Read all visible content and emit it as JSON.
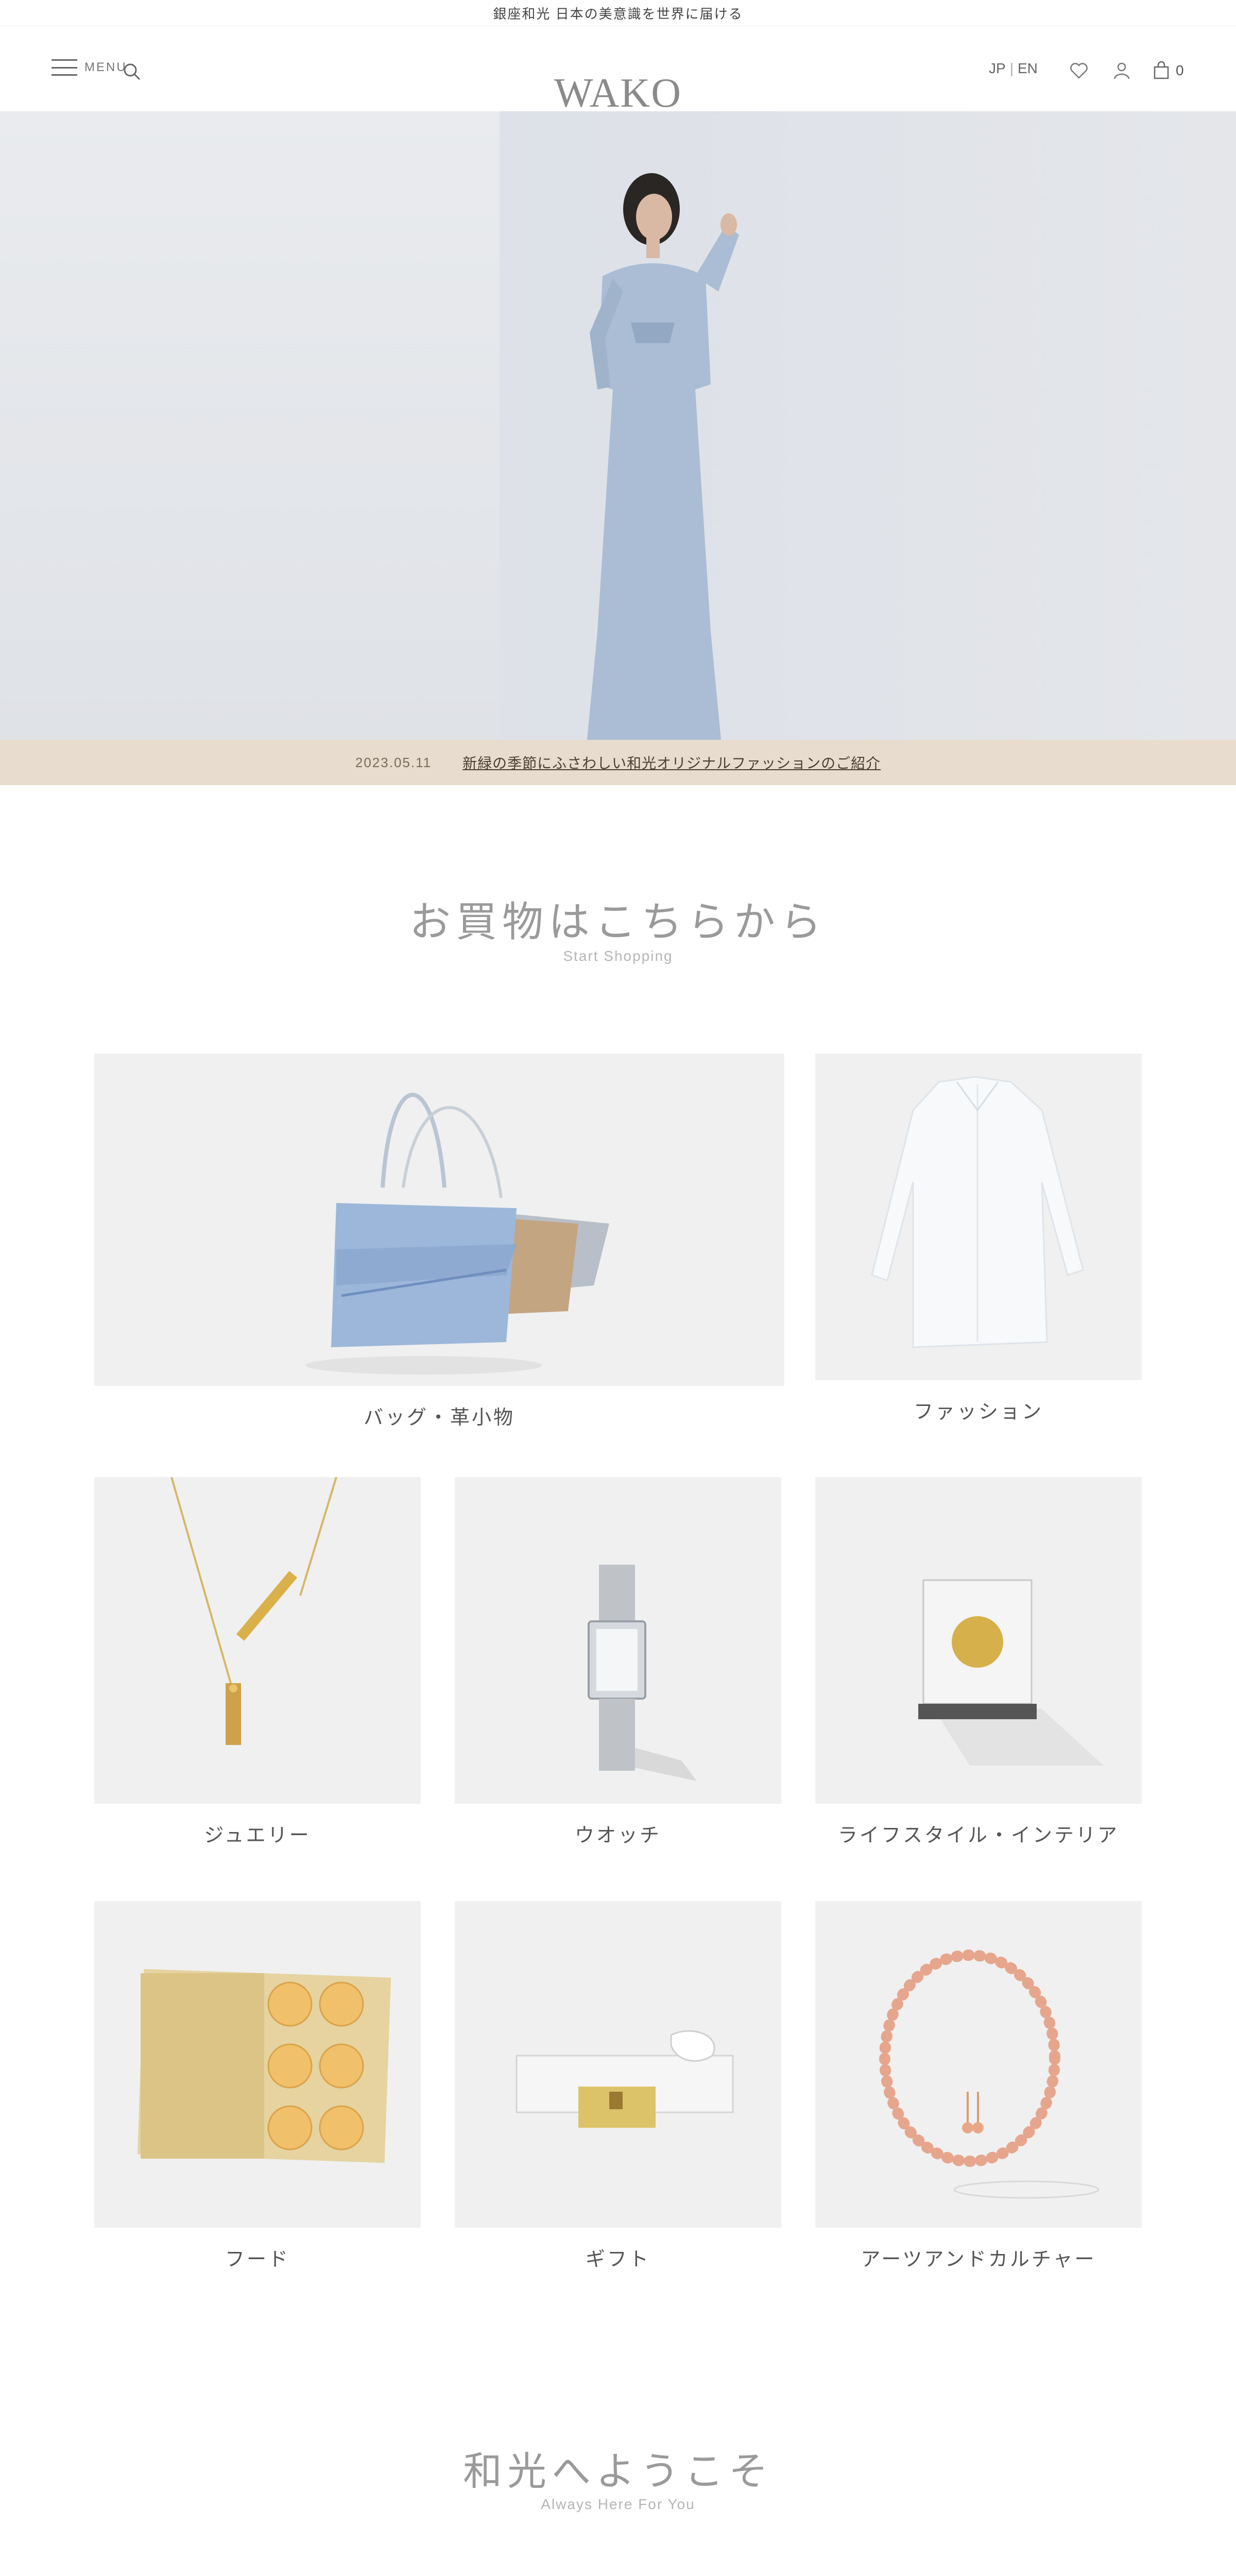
{
  "topbar": {
    "text": "銀座和光 日本の美意識を世界に届ける"
  },
  "header": {
    "menu_label": "MENU",
    "logo": "WAKO",
    "lang_primary": "JP",
    "lang_secondary": "EN",
    "cart_count": "0"
  },
  "announcement": {
    "date": "2023.05.11",
    "text": "新緑の季節にふさわしい和光オリジナルファッションのご紹介"
  },
  "shop": {
    "title": "お買物はこちらから",
    "subtitle": "Start Shopping",
    "categories": [
      {
        "label": "バッグ・革小物"
      },
      {
        "label": "ファッション"
      },
      {
        "label": "ジュエリー"
      },
      {
        "label": "ウオッチ"
      },
      {
        "label": "ライフスタイル・インテリア"
      },
      {
        "label": "フード"
      },
      {
        "label": "ギフト"
      },
      {
        "label": "アーツアンドカルチャー"
      }
    ]
  },
  "welcome": {
    "title": "和光へようこそ",
    "subtitle": "Always Here For You"
  },
  "colors": {
    "announcement_bg": "#e7dccd",
    "card_bg": "#f0f0f0",
    "hero_bg": "#dfe2e7"
  }
}
